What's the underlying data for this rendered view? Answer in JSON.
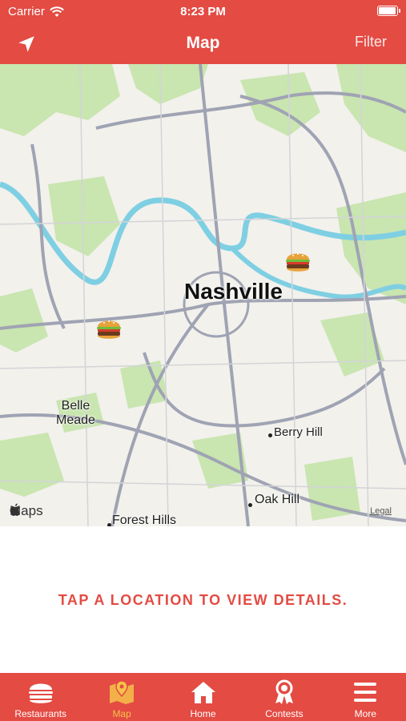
{
  "status_bar": {
    "carrier": "Carrier",
    "time": "8:23 PM",
    "battery_level": 1.0
  },
  "nav": {
    "title": "Map",
    "filter_label": "Filter",
    "left_icon": "location-arrow-icon"
  },
  "map": {
    "city_label": "Nashville",
    "places": {
      "belle_meade": "Belle\nMeade",
      "berry_hill": "Berry Hill",
      "oak_hill": "Oak Hill",
      "forest_hills": "Forest Hills"
    },
    "markers": [
      "burger-marker",
      "burger-marker"
    ],
    "attribution": "Maps",
    "legal": "Legal"
  },
  "details": {
    "prompt": "TAP A LOCATION TO VIEW DETAILS."
  },
  "tabs": [
    {
      "label": "Restaurants",
      "icon": "burger-icon",
      "active": false
    },
    {
      "label": "Map",
      "icon": "map-pin-icon",
      "active": true
    },
    {
      "label": "Home",
      "icon": "home-icon",
      "active": false
    },
    {
      "label": "Contests",
      "icon": "award-ribbon-icon",
      "active": false
    },
    {
      "label": "More",
      "icon": "menu-icon",
      "active": false
    }
  ],
  "colors": {
    "brand_red": "#e34b43",
    "active_tab": "#f6c24a",
    "water": "#7fcfe3",
    "park": "#c9e5b0",
    "road": "#9fa3b3"
  }
}
